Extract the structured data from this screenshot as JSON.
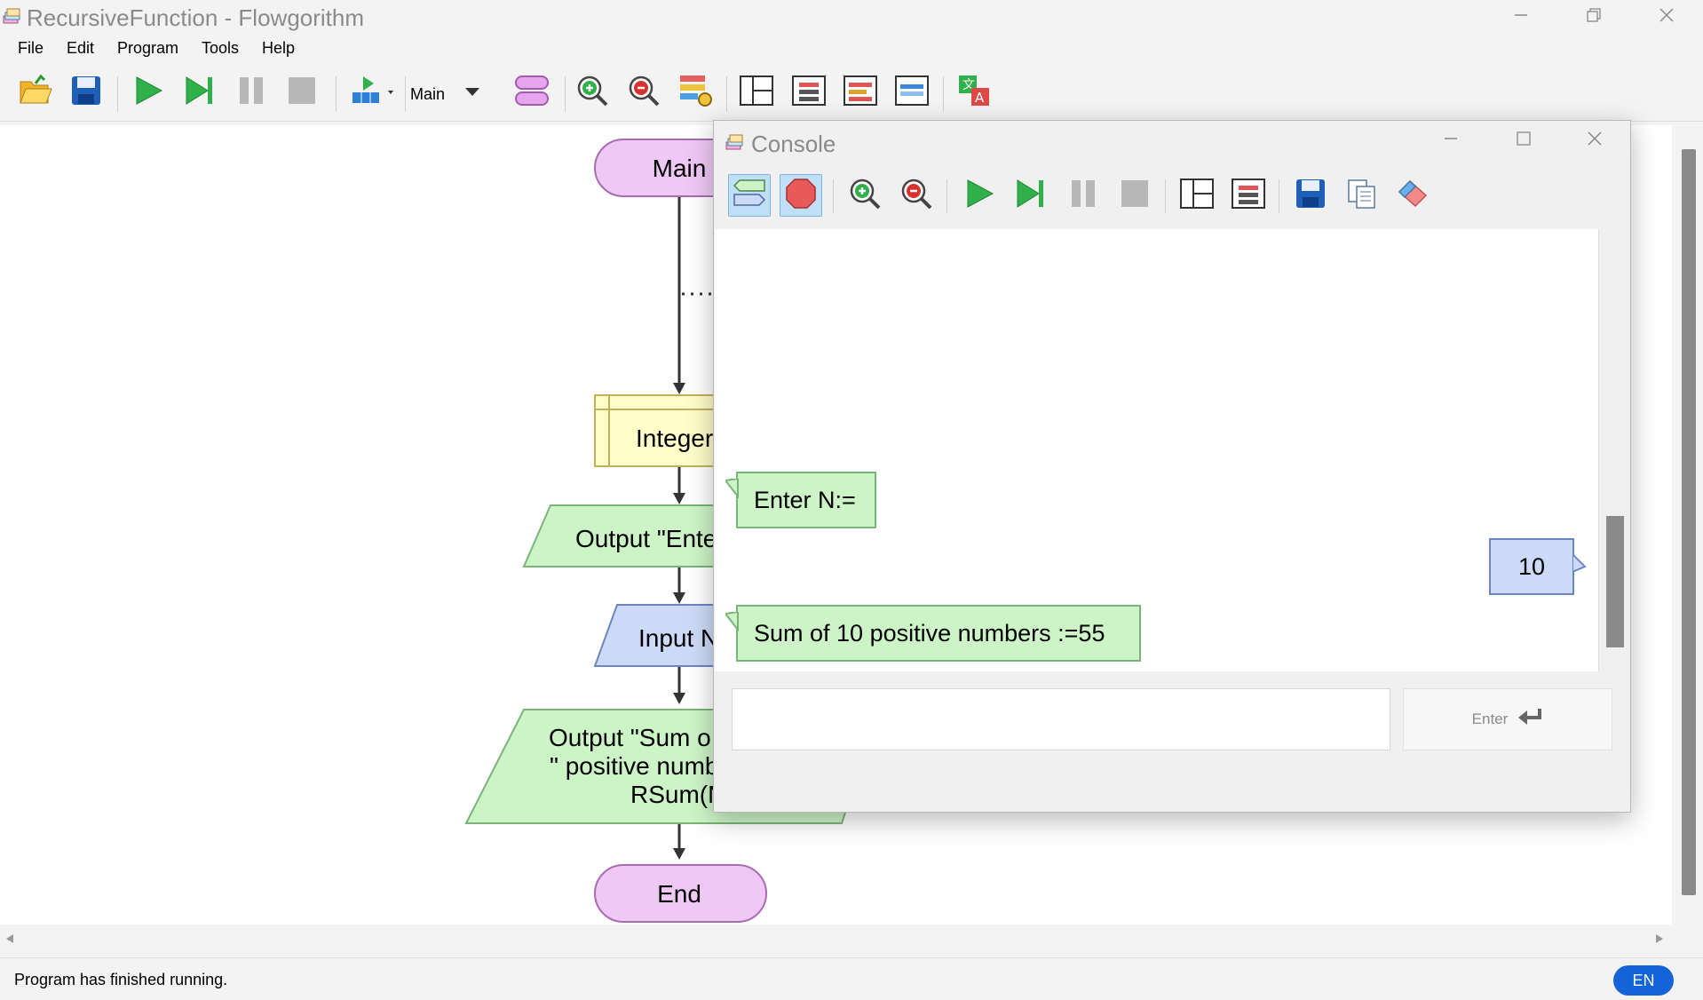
{
  "window": {
    "title": "RecursiveFunction - Flowgorithm"
  },
  "menu": [
    "File",
    "Edit",
    "Program",
    "Tools",
    "Help"
  ],
  "toolbar": {
    "function_select": "Main",
    "icons": [
      "open-folder-icon",
      "save-icon",
      "run-icon",
      "step-icon",
      "pause-icon",
      "stop-icon",
      "step-into-icon",
      "function-shape-icon",
      "zoom-in-icon",
      "zoom-out-icon",
      "layout-settings-icon",
      "layout-1-icon",
      "layout-2-icon",
      "layout-3-icon",
      "layout-4-icon",
      "translate-icon"
    ]
  },
  "flowchart": {
    "start_label": "Main",
    "declare_label": "Integer",
    "output1_label": "Output \"Ente",
    "input_label": "Input N",
    "output2_lines": [
      "Output \"Sum o",
      "\" positive numb",
      "RSum(N"
    ],
    "end_label": "End",
    "colors": {
      "terminal_fill": "#efc8f5",
      "terminal_stroke": "#a86db0",
      "declare_fill": "#fffdc8",
      "declare_stroke": "#c0b25d",
      "output_fill": "#cdf4c7",
      "output_stroke": "#7ab47a",
      "input_fill": "#cddaf7",
      "input_stroke": "#6c86bf"
    }
  },
  "console": {
    "title": "Console",
    "messages": [
      {
        "type": "output",
        "text": "Enter N:="
      },
      {
        "type": "input",
        "text": "10"
      },
      {
        "type": "output",
        "text": "Sum of 10 positive numbers :=55"
      }
    ],
    "input_value": "",
    "enter_label": "Enter"
  },
  "status": {
    "text": "Program has finished running.",
    "language": "EN"
  }
}
